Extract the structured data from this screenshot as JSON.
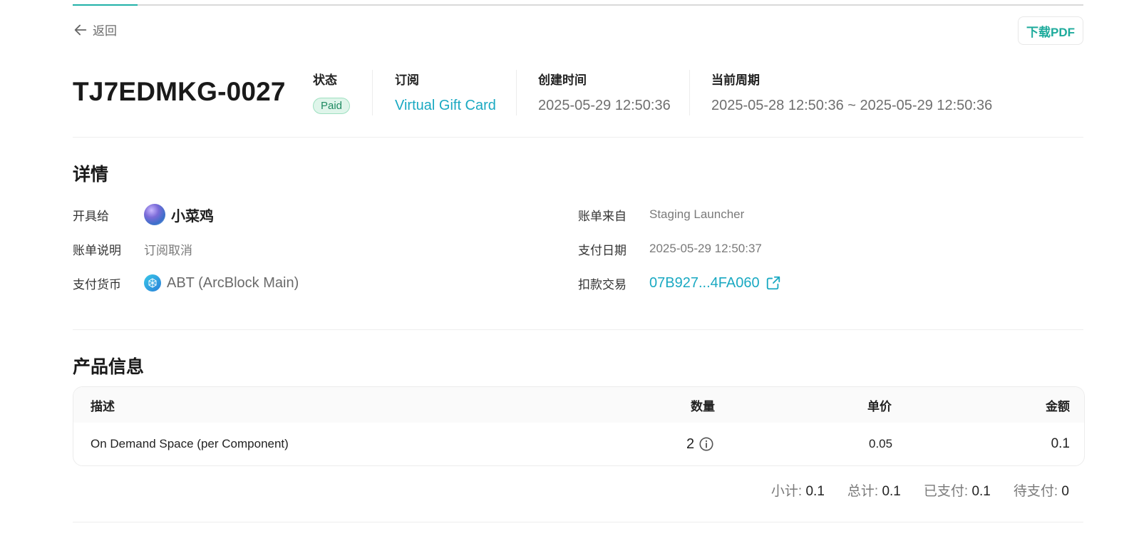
{
  "nav": {
    "back_label": "返回",
    "download_label": "下载PDF"
  },
  "invoice": {
    "number": "TJ7EDMKG-0027",
    "status_label": "状态",
    "status_value": "Paid",
    "subscription_label": "订阅",
    "subscription_value": "Virtual Gift Card",
    "created_label": "创建时间",
    "created_value": "2025-05-29 12:50:36",
    "period_label": "当前周期",
    "period_value": "2025-05-28 12:50:36 ~ 2025-05-29 12:50:36"
  },
  "details": {
    "title": "详情",
    "billed_to_label": "开具给",
    "billed_to_value": "小菜鸡",
    "description_label": "账单说明",
    "description_value": "订阅取消",
    "currency_label": "支付货币",
    "currency_value": "ABT (ArcBlock Main)",
    "source_label": "账单来自",
    "source_value": "Staging Launcher",
    "paid_date_label": "支付日期",
    "paid_date_value": "2025-05-29 12:50:37",
    "tx_label": "扣款交易",
    "tx_value": "07B927...4FA060"
  },
  "products": {
    "title": "产品信息",
    "columns": {
      "description": "描述",
      "quantity": "数量",
      "unit_price": "单价",
      "amount": "金额"
    },
    "rows": [
      {
        "description": "On Demand Space (per Component)",
        "quantity": "2",
        "unit_price": "0.05",
        "amount": "0.1"
      }
    ]
  },
  "totals": {
    "subtotal_label": "小计:",
    "subtotal_value": "0.1",
    "total_label": "总计:",
    "total_value": "0.1",
    "paid_label": "已支付:",
    "paid_value": "0.1",
    "due_label": "待支付:",
    "due_value": "0"
  },
  "colors": {
    "accent": "#20b1a8",
    "link": "#1aa9c2",
    "paid_badge_bg": "#dff5ea",
    "paid_badge_text": "#1f8a61"
  },
  "icons": {
    "back": "arrow-left-icon",
    "external": "external-link-icon",
    "info": "info-icon",
    "coin": "abt-coin-icon",
    "avatar": "user-avatar"
  }
}
